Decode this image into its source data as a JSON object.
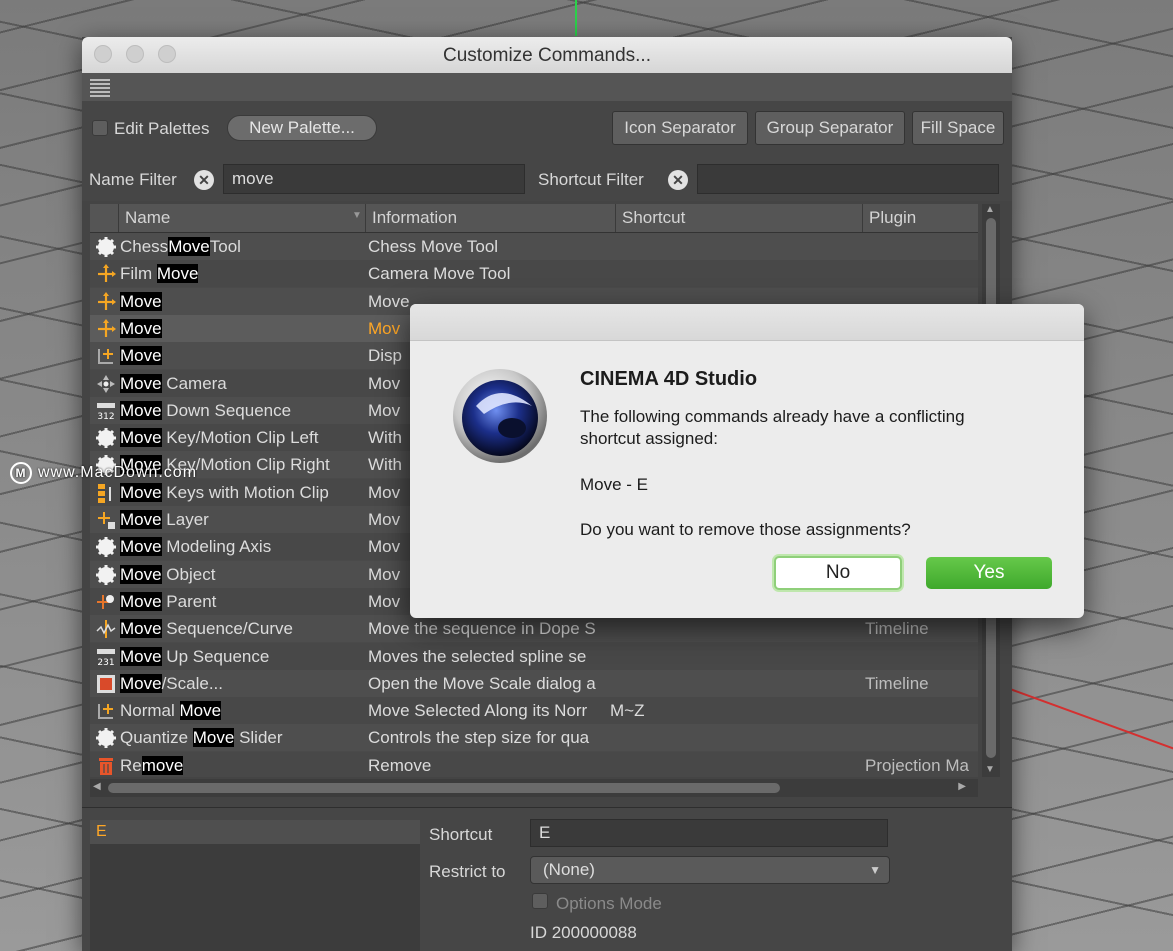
{
  "watermark": {
    "logo": "M",
    "text": "www.MacDown.com"
  },
  "window": {
    "title": "Customize Commands..."
  },
  "toolbar": {
    "edit_palettes": "Edit Palettes",
    "new_palette": "New Palette...",
    "icon_separator": "Icon Separator",
    "group_separator": "Group Separator",
    "fill_space": "Fill Space"
  },
  "filters": {
    "name_label": "Name Filter",
    "name_value": "move",
    "shortcut_label": "Shortcut Filter",
    "shortcut_value": "",
    "clear_glyph": "✕"
  },
  "table": {
    "columns": [
      "Name",
      "Information",
      "Shortcut",
      "Plugin"
    ],
    "rows": [
      {
        "icon": "gear-icon",
        "name_parts": [
          "Chess",
          "Move",
          "Tool"
        ],
        "hl": 1,
        "info": "Chess Move Tool",
        "shortcut": "",
        "plugin": ""
      },
      {
        "icon": "move-arrows-icon",
        "name_parts": [
          "Film ",
          "Move",
          ""
        ],
        "hl": 1,
        "info": "Camera Move Tool",
        "shortcut": "",
        "plugin": ""
      },
      {
        "icon": "move-arrows-icon",
        "name_parts": [
          "",
          "Move",
          ""
        ],
        "hl": 1,
        "info": "Move",
        "shortcut": "",
        "plugin": ""
      },
      {
        "icon": "move-arrows-icon",
        "name_parts": [
          "",
          "Move",
          ""
        ],
        "hl": 1,
        "info": "Mov",
        "shortcut": "",
        "plugin": "",
        "selected": true
      },
      {
        "icon": "move-corner-icon",
        "name_parts": [
          "",
          "Move",
          ""
        ],
        "hl": 1,
        "info": "Disp",
        "shortcut": "",
        "plugin": ""
      },
      {
        "icon": "camera-move-icon",
        "name_parts": [
          "",
          "Move",
          " Camera"
        ],
        "hl": 1,
        "info": "Mov",
        "shortcut": "",
        "plugin": ""
      },
      {
        "icon": "sequence-down-icon",
        "name_parts": [
          "",
          "Move",
          " Down Sequence"
        ],
        "hl": 1,
        "info": "Mov",
        "shortcut": "",
        "plugin": ""
      },
      {
        "icon": "gear-icon",
        "name_parts": [
          "",
          "Move",
          " Key/Motion Clip Left"
        ],
        "hl": 1,
        "info": "With",
        "shortcut": "",
        "plugin": ""
      },
      {
        "icon": "gear-icon",
        "name_parts": [
          "",
          "Move",
          " Key/Motion Clip Right"
        ],
        "hl": 1,
        "info": "With",
        "shortcut": "",
        "plugin": ""
      },
      {
        "icon": "keys-clip-icon",
        "name_parts": [
          "",
          "Move",
          " Keys with Motion Clip"
        ],
        "hl": 1,
        "info": "Mov",
        "shortcut": "",
        "plugin": ""
      },
      {
        "icon": "move-layer-icon",
        "name_parts": [
          "",
          "Move",
          " Layer"
        ],
        "hl": 1,
        "info": "Mov",
        "shortcut": "",
        "plugin": ""
      },
      {
        "icon": "gear-icon",
        "name_parts": [
          "",
          "Move",
          " Modeling Axis"
        ],
        "hl": 1,
        "info": "Mov",
        "shortcut": "",
        "plugin": ""
      },
      {
        "icon": "gear-icon",
        "name_parts": [
          "",
          "Move",
          " Object"
        ],
        "hl": 1,
        "info": "Mov",
        "shortcut": "",
        "plugin": ""
      },
      {
        "icon": "move-parent-icon",
        "name_parts": [
          "",
          "Move",
          " Parent"
        ],
        "hl": 1,
        "info": "Mov",
        "shortcut": "",
        "plugin": ""
      },
      {
        "icon": "sequence-curve-icon",
        "name_parts": [
          "",
          "Move",
          " Sequence/Curve"
        ],
        "hl": 1,
        "info": "Move the sequence in Dope S",
        "shortcut": "",
        "plugin": "Timeline"
      },
      {
        "icon": "sequence-up-icon",
        "name_parts": [
          "",
          "Move",
          " Up Sequence"
        ],
        "hl": 1,
        "info": "Moves the selected spline se",
        "shortcut": "",
        "plugin": ""
      },
      {
        "icon": "move-scale-icon",
        "name_parts": [
          "",
          "Move",
          "/Scale..."
        ],
        "hl": 1,
        "info": "Open the Move Scale dialog a",
        "shortcut": "",
        "plugin": "Timeline"
      },
      {
        "icon": "move-corner-icon",
        "name_parts": [
          "Normal ",
          "Move",
          ""
        ],
        "hl": 1,
        "info": "Move Selected Along its Norr",
        "shortcut": "M~Z",
        "plugin": ""
      },
      {
        "icon": "gear-icon",
        "name_parts": [
          "Quantize ",
          "Move",
          " Slider"
        ],
        "hl": 1,
        "info": "Controls the step size for qua",
        "shortcut": "",
        "plugin": ""
      },
      {
        "icon": "trash-icon",
        "name_parts": [
          "Re",
          "move",
          ""
        ],
        "hl": 1,
        "info": "Remove",
        "shortcut": "",
        "plugin": "Projection Ma"
      }
    ]
  },
  "bottom": {
    "key_item": "E",
    "shortcut_label": "Shortcut",
    "shortcut_value": "E",
    "restrict_label": "Restrict to",
    "restrict_value": "(None)",
    "options_mode": "Options Mode",
    "id_text": "ID 200000088"
  },
  "dialog": {
    "title": "CINEMA 4D Studio",
    "message_line1": "The following commands already have a conflicting",
    "message_line2": "shortcut assigned:",
    "conflict": "Move - E",
    "question": "Do you want to remove those assignments?",
    "no_label": "No",
    "yes_label": "Yes"
  },
  "colors": {
    "highlight_bg": "#000000",
    "selected_text": "#ffa726",
    "yes_button": "#4fb73a",
    "no_button_border": "#8fcf7a"
  }
}
